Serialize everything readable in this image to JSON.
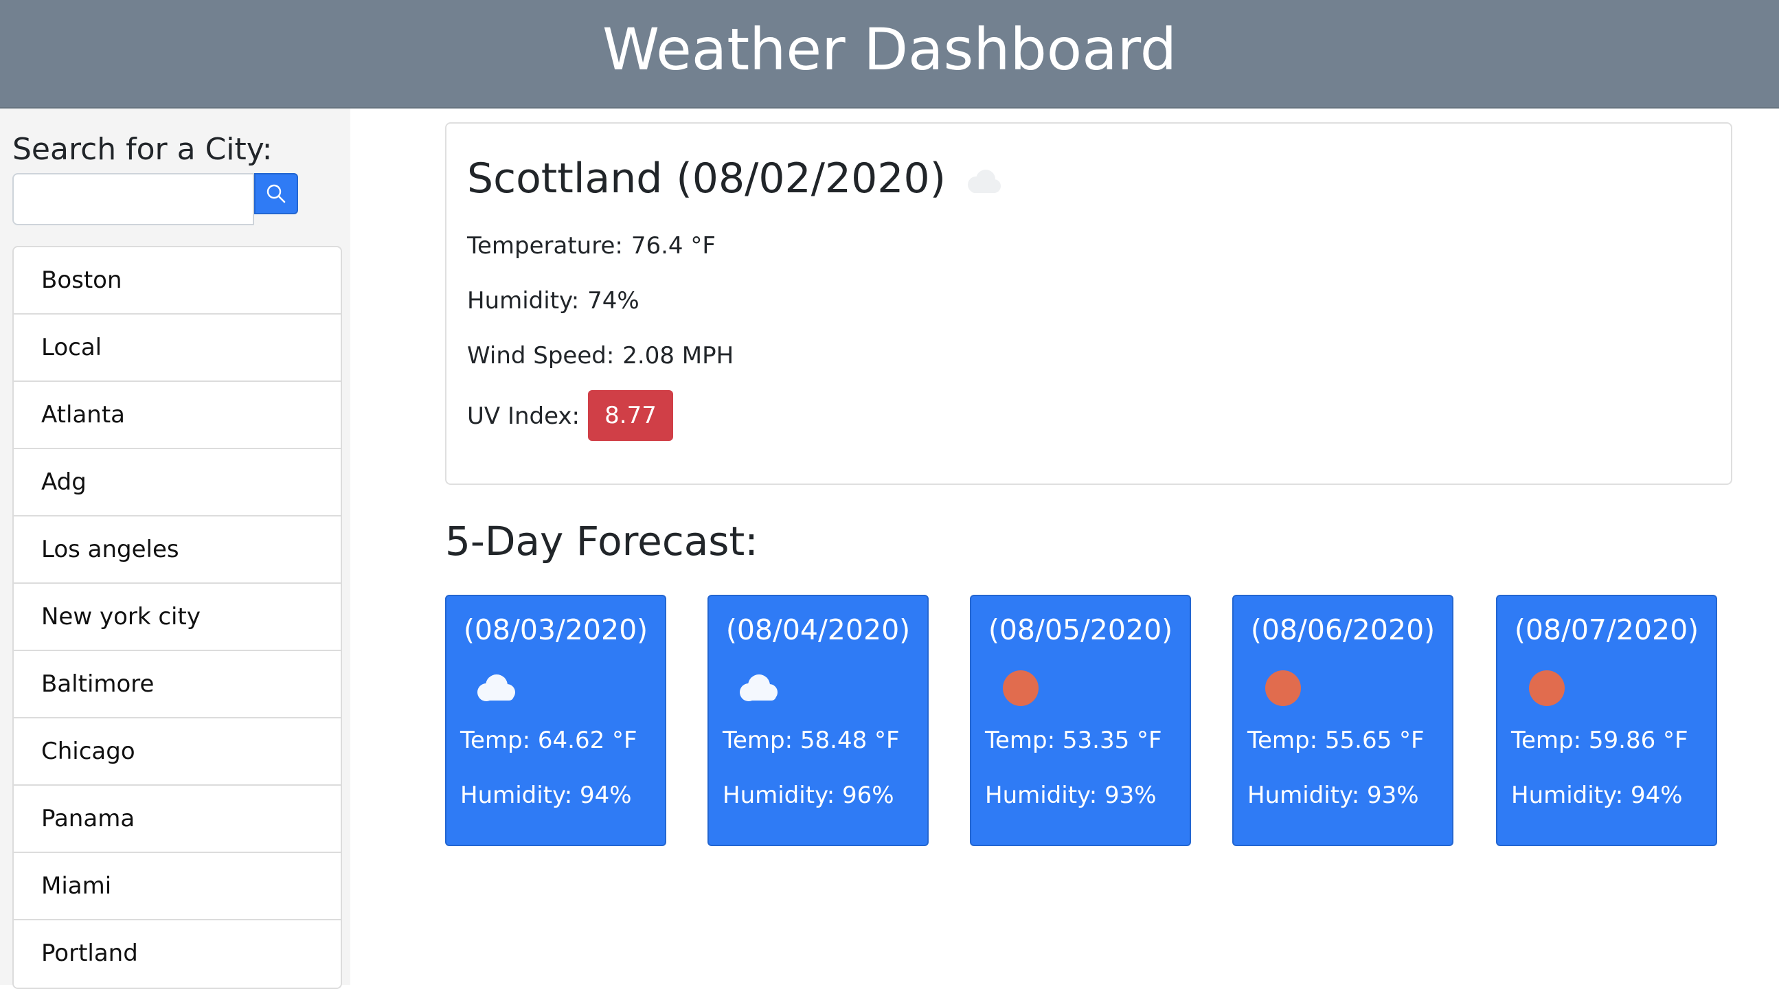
{
  "app": {
    "title": "Weather Dashboard"
  },
  "search": {
    "label": "Search for a City:",
    "value": "",
    "placeholder": "",
    "button_icon": "search-icon"
  },
  "cities": [
    "Boston",
    "Local",
    "Atlanta",
    "Adg",
    "Los angeles",
    "New york city",
    "Baltimore",
    "Chicago",
    "Panama",
    "Miami",
    "Portland"
  ],
  "current": {
    "city": "Scottland",
    "date": "(08/02/2020)",
    "icon": "cloud-icon",
    "temperature_label": "Temperature:",
    "temperature_value": "76.4 °F",
    "humidity_label": "Humidity:",
    "humidity_value": "74%",
    "wind_label": "Wind Speed:",
    "wind_value": "2.08 MPH",
    "uv_label": "UV Index:",
    "uv_value": "8.77"
  },
  "forecast": {
    "heading": "5-Day Forecast:",
    "days": [
      {
        "date": "(08/03/2020)",
        "icon": "cloud-icon",
        "temp": "Temp: 64.62 °F",
        "humidity": "Humidity: 94%"
      },
      {
        "date": "(08/04/2020)",
        "icon": "cloud-icon",
        "temp": "Temp: 58.48 °F",
        "humidity": "Humidity: 96%"
      },
      {
        "date": "(08/05/2020)",
        "icon": "sun-icon",
        "temp": "Temp: 53.35 °F",
        "humidity": "Humidity: 93%"
      },
      {
        "date": "(08/06/2020)",
        "icon": "sun-icon",
        "temp": "Temp: 55.65 °F",
        "humidity": "Humidity: 93%"
      },
      {
        "date": "(08/07/2020)",
        "icon": "sun-icon",
        "temp": "Temp: 59.86 °F",
        "humidity": "Humidity: 94%"
      }
    ]
  },
  "colors": {
    "header_bg": "#738190",
    "accent_blue": "#2f7bf5",
    "uv_severe": "#d03f47",
    "sun": "#e16c4e"
  }
}
